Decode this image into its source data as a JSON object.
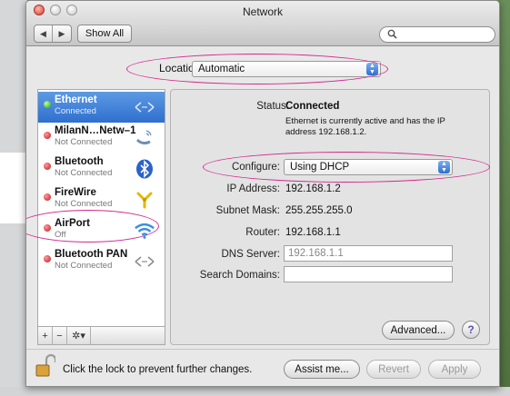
{
  "window": {
    "title": "Network"
  },
  "toolbar": {
    "back_glyph": "◀",
    "forward_glyph": "▶",
    "show_all_label": "Show All",
    "search_placeholder": ""
  },
  "location": {
    "label": "Location:",
    "value": "Automatic"
  },
  "services": [
    {
      "name": "Ethernet",
      "status": "Connected",
      "icon": "ethernet-arrows-icon",
      "state": "green",
      "selected": true
    },
    {
      "name": "MilanN…Netw–1",
      "status": "Not Connected",
      "icon": "phone-signal-icon",
      "state": "red"
    },
    {
      "name": "Bluetooth",
      "status": "Not Connected",
      "icon": "bluetooth-icon",
      "state": "red"
    },
    {
      "name": "FireWire",
      "status": "Not Connected",
      "icon": "firewire-icon",
      "state": "red"
    },
    {
      "name": "AirPort",
      "status": "Off",
      "icon": "wifi-icon",
      "state": "red"
    },
    {
      "name": "Bluetooth PAN",
      "status": "Not Connected",
      "icon": "bluetooth-pan-icon",
      "state": "red"
    }
  ],
  "sidebar_buttons": {
    "add": "+",
    "remove": "−",
    "action": "✲▾"
  },
  "details": {
    "status_label": "Status:",
    "status_value": "Connected",
    "status_desc_line1": "Ethernet is currently active and has the IP",
    "status_desc_line2": "address 192.168.1.2.",
    "configure_label": "Configure:",
    "configure_value": "Using DHCP",
    "ip_label": "IP Address:",
    "ip_value": "192.168.1.2",
    "subnet_label": "Subnet Mask:",
    "subnet_value": "255.255.255.0",
    "router_label": "Router:",
    "router_value": "192.168.1.1",
    "dns_label": "DNS Server:",
    "dns_value": "192.168.1.1",
    "search_domains_label": "Search Domains:",
    "search_domains_value": ""
  },
  "buttons": {
    "advanced": "Advanced...",
    "help": "?",
    "assist": "Assist me...",
    "revert": "Revert",
    "apply": "Apply"
  },
  "lock_text": "Click the lock to prevent further changes.",
  "colors": {
    "highlight_ellipse": "#d2298f",
    "selection_blue": "#2f6fce"
  }
}
